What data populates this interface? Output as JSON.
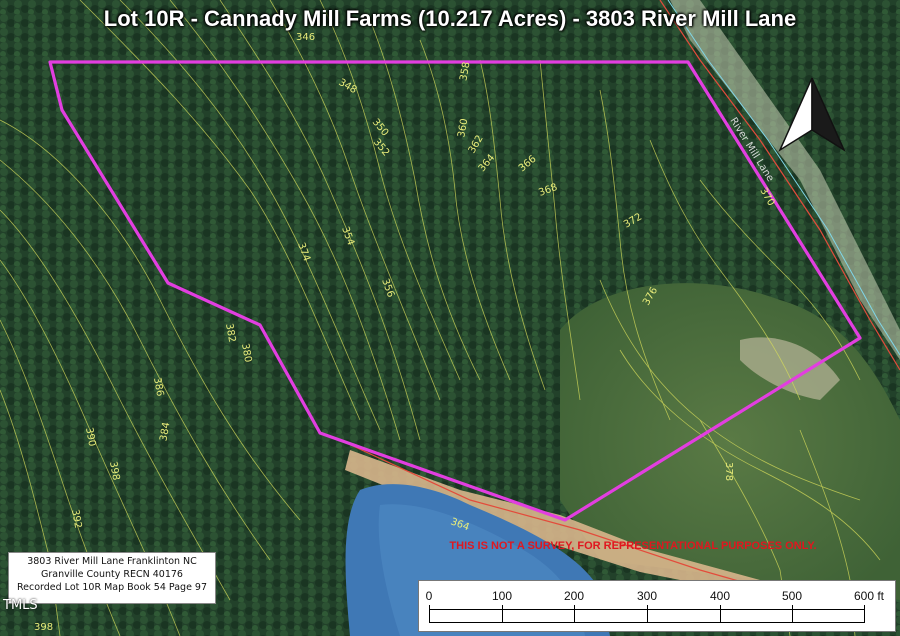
{
  "title": "Lot 10R - Cannady Mill Farms (10.217 Acres) - 3803 River Mill Lane",
  "road_label": "River Mill Lane",
  "contour_labels": [
    "346",
    "348",
    "350",
    "352",
    "356",
    "358",
    "360",
    "362",
    "364",
    "366",
    "368",
    "370",
    "372",
    "374",
    "376",
    "378",
    "380",
    "382",
    "384",
    "386",
    "390",
    "392",
    "398",
    "354",
    "364",
    "398"
  ],
  "info_box": {
    "line1": "3803 River Mill Lane Franklinton NC",
    "line2": "Granville County RECN 40176",
    "line3": "Recorded Lot 10R  Map Book 54 Page 97"
  },
  "watermark": "TMLS",
  "disclaimer": "THIS IS NOT A SURVEY, FOR REPRESENTATIONAL PURPOSES ONLY.",
  "scale_bar": {
    "unit": "ft",
    "ticks": [
      "0",
      "100",
      "200",
      "300",
      "400",
      "500",
      "600 ft"
    ]
  },
  "colors": {
    "boundary": "#e23ee0",
    "contour": "#d6dc5a",
    "forest": "#24452a",
    "field": "#4e7040",
    "water": "#3f78b5",
    "disclaimer": "#e0171f"
  },
  "icons": {
    "north_arrow": "north-arrow-icon"
  }
}
